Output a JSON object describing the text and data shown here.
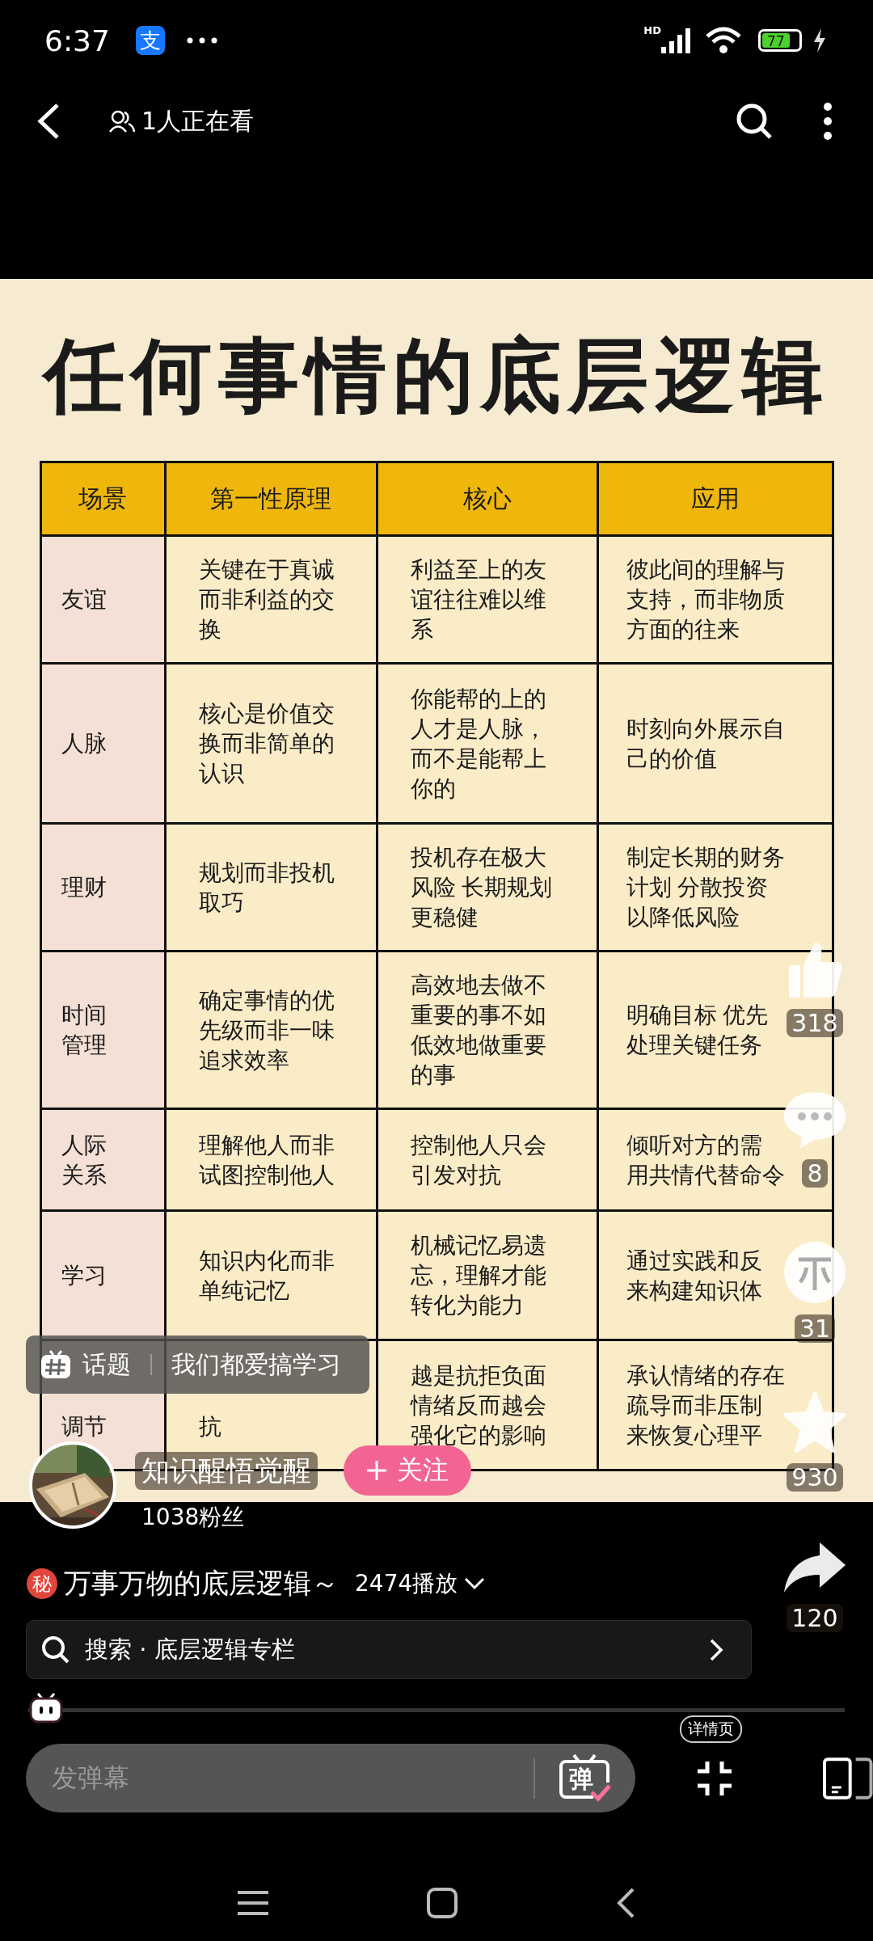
{
  "status_bar": {
    "time": "6:37",
    "app_badge": "支",
    "network": "HD",
    "battery": "77"
  },
  "top_bar": {
    "viewers": "1人正在看"
  },
  "video": {
    "title": "任何事情的底层逻辑",
    "table": {
      "columns": [
        "场景",
        "第一性原理",
        "核心",
        "应用"
      ],
      "rows": [
        [
          "友谊",
          "关键在于真诚而非利益的交换",
          "利益至上的友谊往往难以维系",
          "彼此间的理解与支持，而非物质方面的往来"
        ],
        [
          "人脉",
          "核心是价值交换而非简单的认识",
          "你能帮的上的人才是人脉，而不是能帮上你的",
          "时刻向外展示自己的价值"
        ],
        [
          "理财",
          "规划而非投机取巧",
          "投机存在极大风险 长期规划更稳健",
          "制定长期的财务计划 分散投资以降低风险"
        ],
        [
          "时间管理",
          "确定事情的优先级而非一味追求效率",
          "高效地去做不重要的事不如低效地做重要的事",
          "明确目标 优先处理关键任务"
        ],
        [
          "人际关系",
          "理解他人而非试图控制他人",
          "控制他人只会引发对抗",
          "倾听对方的需用共情代替命令"
        ],
        [
          "学习",
          "知识内化而非单纯记忆",
          "机械记忆易遗忘，理解才能转化为能力",
          "通过实践和反来构建知识体"
        ],
        [
          "调节",
          "抗",
          "越是抗拒负面情绪反而越会强化它的影响",
          "承认情绪的存在疏导而非压制来恢复心理平"
        ]
      ]
    }
  },
  "topic": {
    "label": "话题",
    "name": "我们都爱搞学习"
  },
  "author": {
    "name": "知识醒悟觉醒",
    "follow": "关注",
    "fans": "1038粉丝"
  },
  "actions": [
    {
      "kind": "like",
      "count": "318"
    },
    {
      "kind": "comment",
      "count": "8"
    },
    {
      "kind": "coin",
      "count": "31"
    },
    {
      "kind": "favorite",
      "count": "930"
    },
    {
      "kind": "share",
      "count": "120"
    }
  ],
  "caption": {
    "badge": "秘",
    "title": "万事万物的底层逻辑～",
    "plays": "2474播放"
  },
  "search": {
    "text": "搜索 · 底层逻辑专栏"
  },
  "progress": {
    "level": 0.0
  },
  "danmaku": {
    "placeholder": "发弹幕",
    "badge": "弹",
    "details": "详情页"
  }
}
